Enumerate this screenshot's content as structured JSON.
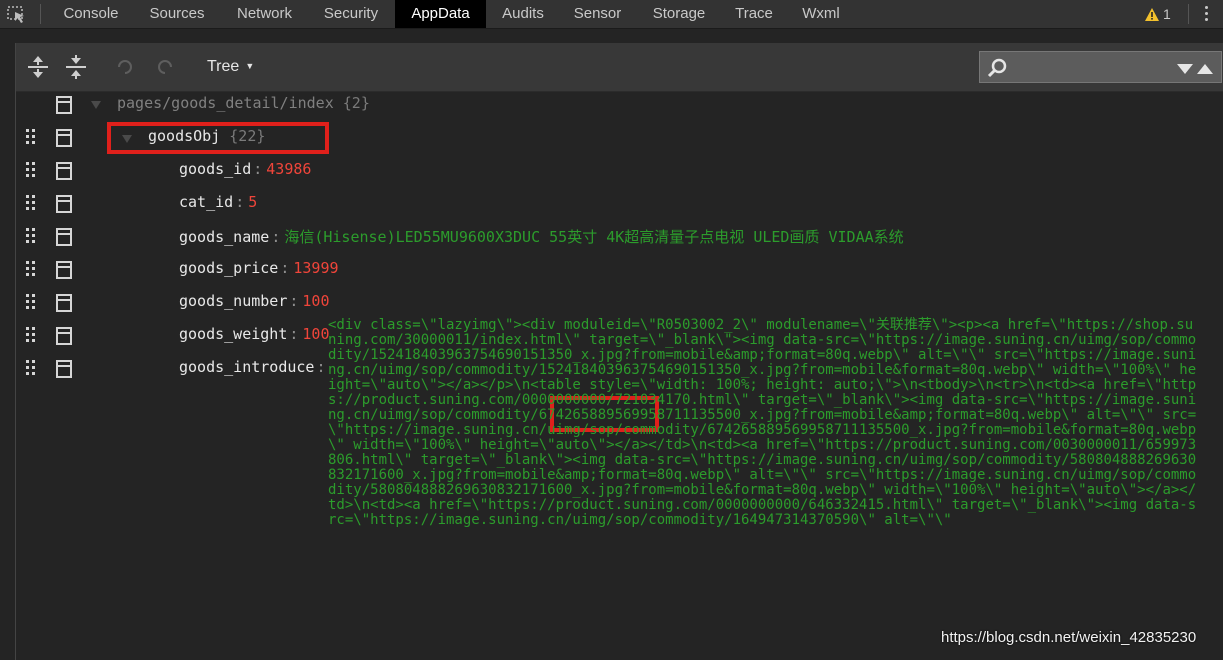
{
  "tabs": [
    {
      "label": "Console",
      "active": false
    },
    {
      "label": "Sources",
      "active": false
    },
    {
      "label": "Network",
      "active": false
    },
    {
      "label": "Security",
      "active": false
    },
    {
      "label": "AppData",
      "active": true
    },
    {
      "label": "Audits",
      "active": false
    },
    {
      "label": "Sensor",
      "active": false
    },
    {
      "label": "Storage",
      "active": false
    },
    {
      "label": "Trace",
      "active": false
    },
    {
      "label": "Wxml",
      "active": false
    }
  ],
  "warnings": {
    "count": "1",
    "icon": "warning-icon",
    "color": "#f3c12d"
  },
  "toolbar": {
    "view_mode": "Tree",
    "search": {
      "placeholder": "",
      "value": ""
    }
  },
  "tree": {
    "root": {
      "path": "pages/goods_detail/index",
      "count": "{2}"
    },
    "object": {
      "key": "goodsObj",
      "count": "{22}"
    },
    "fields": [
      {
        "key": "goods_id",
        "value": "43986",
        "type": "number"
      },
      {
        "key": "cat_id",
        "value": "5",
        "type": "number"
      },
      {
        "key": "goods_name",
        "value": "海信(Hisense)LED55MU9600X3DUC 55英寸 4K超高清量子点电视 ULED画质 VIDAA系统",
        "type": "string"
      },
      {
        "key": "goods_price",
        "value": "13999",
        "type": "number"
      },
      {
        "key": "goods_number",
        "value": "100",
        "type": "number"
      },
      {
        "key": "goods_weight",
        "value": "100",
        "type": "number"
      }
    ],
    "introduce": {
      "key": "goods_introduce",
      "value": "<div class=\\\"lazyimg\\\"><div moduleid=\\\"R0503002_2\\\" modulename=\\\"关联推荐\\\"><p><a href=\\\"https://shop.suning.com/30000011/index.html\\\" target=\\\"_blank\\\"><img data-src=\\\"https://image.suning.cn/uimg/sop/commodity/152418403963754690151350_x.jpg?from=mobile&amp;format=80q.webp\\\" alt=\\\"\\\" src=\\\"https://image.suning.cn/uimg/sop/commodity/152418403963754690151350_x.jpg?from=mobile&format=80q.webp\\\" width=\\\"100%\\\" height=\\\"auto\\\"></a></p>\\n<table style=\\\"width: 100%; height: auto;\\\">\\n<tbody>\\n<tr>\\n<td><a href=\\\"https://product.suning.com/0000000000/721034170.html\\\" target=\\\"_blank\\\"><img data-src=\\\"https://image.suning.cn/uimg/sop/commodity/674265889569958711135500_x.jpg?from=mobile&amp;format=80q.webp\\\" alt=\\\"\\\" src=\\\"https://image.suning.cn/uimg/sop/commodity/674265889569958711135500_x.jpg?from=mobile&format=80q.webp\\\" width=\\\"100%\\\" height=\\\"auto\\\"></a></td>\\n<td><a href=\\\"https://product.suning.com/0030000011/659973806.html\\\" target=\\\"_blank\\\"><img data-src=\\\"https://image.suning.cn/uimg/sop/commodity/580804888269630832171600_x.jpg?from=mobile&amp;format=80q.webp\\\" alt=\\\"\\\" src=\\\"https://image.suning.cn/uimg/sop/commodity/580804888269630832171600_x.jpg?from=mobile&format=80q.webp\\\" width=\\\"100%\\\" height=\\\"auto\\\"></a></td>\\n<td><a href=\\\"https://product.suning.com/0000000000/646332415.html\\\" target=\\\"_blank\\\"><img data-src=\\\"https://image.suning.cn/uimg/sop/commodity/164947314370590\\\" alt=\\\"\\\""
    }
  },
  "watermark": "https://blog.csdn.net/weixin_42835230"
}
